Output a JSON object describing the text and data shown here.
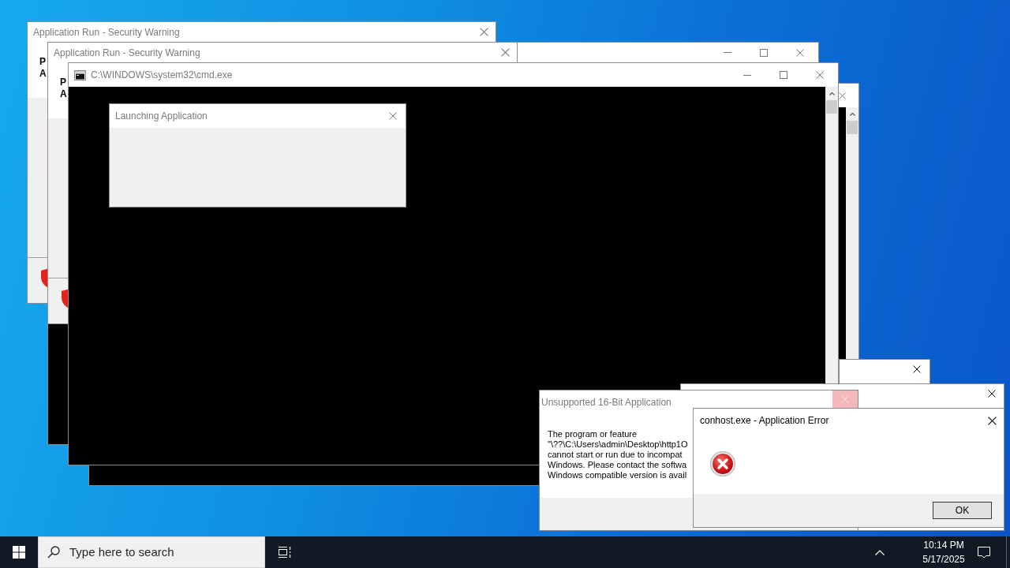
{
  "windows": [
    {
      "kind": "security",
      "active": false,
      "title": "Application Run - Security Warning",
      "fields": [
        "P",
        "A"
      ]
    },
    {
      "kind": "console",
      "active": false
    },
    {
      "kind": "security",
      "active": false,
      "title": "Application Run - Security Warning",
      "fields": [
        "P",
        "A"
      ]
    },
    {
      "kind": "console",
      "active": false,
      "scrollbar": true
    },
    {
      "kind": "console",
      "active": false,
      "title": "C:\\WINDOWS\\system32\\cmd.exe",
      "scrollbar": true
    },
    {
      "kind": "dialog",
      "active": false,
      "title": "Launching Application"
    },
    {
      "kind": "blank",
      "active": true
    },
    {
      "kind": "blank",
      "active": true
    },
    {
      "kind": "message",
      "active": false,
      "title": "Unsupported 16-Bit Application",
      "close_hovered": true,
      "message_lines": [
        "The program or feature",
        "\"\\??\\C:\\Users\\admin\\Desktop\\http1O",
        "cannot start or run due to incompat",
        "Windows. Please contact the softwa",
        "Windows compatible version is avail"
      ]
    },
    {
      "kind": "error",
      "active": true,
      "title": "conhost.exe - Application Error",
      "button": "OK"
    }
  ],
  "taskbar": {
    "search": {
      "placeholder": "Type here to search"
    },
    "clock": {
      "time": "10:14 PM",
      "date": "5/17/2025"
    }
  }
}
